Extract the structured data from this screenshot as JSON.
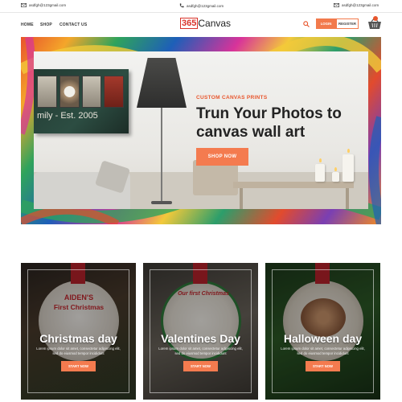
{
  "topbar": {
    "email_left": "asdfgh@123gmail.com",
    "phone": "asdfgh@123gmail.com",
    "email_right": "asdfgh@123gmail.com"
  },
  "nav": {
    "links": [
      "HOME",
      "SHOP",
      "CONTACT US"
    ],
    "logo_badge": "365",
    "logo_text": "Canvas",
    "login_label": "LOGIN",
    "register_label": "REGISTER"
  },
  "hero": {
    "subtitle": "CUSTOM CANVAS PRINTS",
    "title": "Trun Your Photos to canvas wall art",
    "button_label": "SHOP NOW",
    "canvas_text": "mily - Est. 2005"
  },
  "cards": [
    {
      "title": "Christmas day",
      "description": "Lorem ipsum dolor sit amet, consectetur adipiscing elit, sed do eiusmod tempor incididunt",
      "button_label": "START NOW",
      "ornament_line1": "AIDEN'S",
      "ornament_line2": "First Christmas"
    },
    {
      "title": "Valentines Day",
      "description": "Lorem ipsum dolor sit amet, consectetur adipiscing elit, sed do eiusmod tempor incididunt",
      "button_label": "START NOW",
      "ornament_line1": "Our first Christmas"
    },
    {
      "title": "Halloween day",
      "description": "Lorem ipsum dolor sit amet, consectetur adipiscing elit, sed do eiusmod tempor incididunt",
      "button_label": "START NOW"
    }
  ],
  "colors": {
    "accent": "#f47b4f",
    "logo_red": "#d9342b",
    "heading": "#232323"
  },
  "icons": [
    "mail-icon",
    "phone-icon",
    "search-icon",
    "cart-icon"
  ]
}
